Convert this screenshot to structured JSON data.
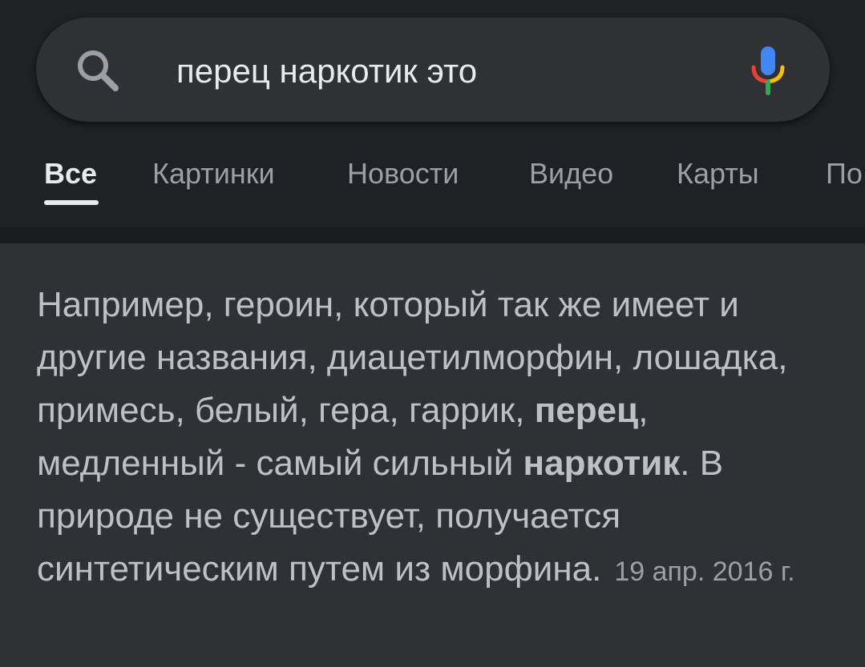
{
  "search": {
    "query": "перец наркотик это"
  },
  "tabs": [
    {
      "label": "Все",
      "active": true
    },
    {
      "label": "Картинки",
      "active": false
    },
    {
      "label": "Новости",
      "active": false
    },
    {
      "label": "Видео",
      "active": false
    },
    {
      "label": "Карты",
      "active": false
    },
    {
      "label": "По",
      "active": false
    }
  ],
  "snippet": {
    "part1": "Например, героин, который так же имеет и другие названия, диацетилморфин, лошадка, примесь, белый, гера, гаррик, ",
    "bold1": "перец",
    "part2": ", медленный - самый сильный ",
    "bold2": "наркотик",
    "part3": ". В природе не существует, получается синтетическим путем из морфина.",
    "date": "19 апр. 2016 г."
  },
  "icons": {
    "search": "search-icon",
    "mic": "mic-icon"
  },
  "colors": {
    "background": "#303134",
    "header_background": "#202124",
    "text_primary": "#e8eaed",
    "text_secondary": "#9aa0a6",
    "snippet_text": "#bdc1c6",
    "mic_blue": "#4285f4",
    "mic_red": "#ea4335",
    "mic_yellow": "#fbbc05",
    "mic_green": "#34a853"
  }
}
